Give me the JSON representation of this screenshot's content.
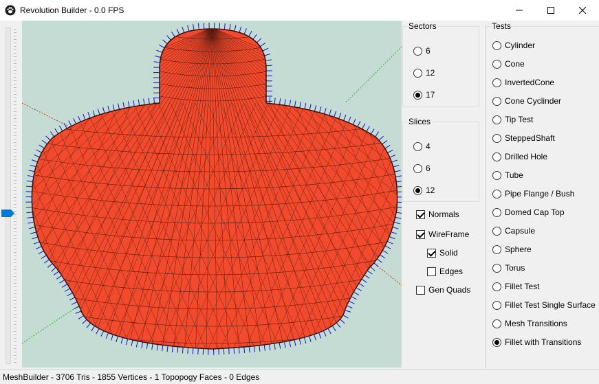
{
  "window": {
    "title": "Revolution Builder - 0.0 FPS",
    "status": "MeshBuilder - 3706 Tris - 1855 Vertices - 1 Topopogy Faces - 0 Edges"
  },
  "colors": {
    "viewport_bg": "#c4dcd4",
    "mesh_fill": "#f24a2c",
    "wire": "#5a1a10",
    "normals": "#1010c8",
    "axis_green": "#1fb81f",
    "axis_red": "#c03030",
    "slider_thumb": "#0078d7"
  },
  "slider": {
    "level": 0.55
  },
  "sectors": {
    "label": "Sectors",
    "options": [
      "6",
      "12",
      "17"
    ],
    "selected": "17"
  },
  "slices": {
    "label": "Slices",
    "options": [
      "4",
      "6",
      "12"
    ],
    "selected": "12"
  },
  "toggles": {
    "normals": {
      "label": "Normals",
      "checked": true
    },
    "wireframe": {
      "label": "WireFrame",
      "checked": true
    },
    "solid": {
      "label": "Solid",
      "checked": true
    },
    "edges": {
      "label": "Edges",
      "checked": false
    },
    "gen_quads": {
      "label": "Gen Quads",
      "checked": false
    }
  },
  "tests": {
    "label": "Tests",
    "options": [
      "Cylinder",
      "Cone",
      "InvertedCone",
      "Cone Cyclinder",
      "Tip Test",
      "SteppedShaft",
      "Drilled Hole",
      "Tube",
      "Pipe Flange / Bush",
      "Domed Cap Top",
      "Capsule",
      "Sphere",
      "Torus",
      "Fillet Test",
      "Fillet Test Single Surface",
      "Mesh Transitions",
      "Fillet with Transitions"
    ],
    "selected": "Fillet with Transitions"
  },
  "icons": {
    "app": "paw-icon",
    "minimize": "minimize-icon",
    "maximize": "maximize-icon",
    "close": "close-icon"
  }
}
